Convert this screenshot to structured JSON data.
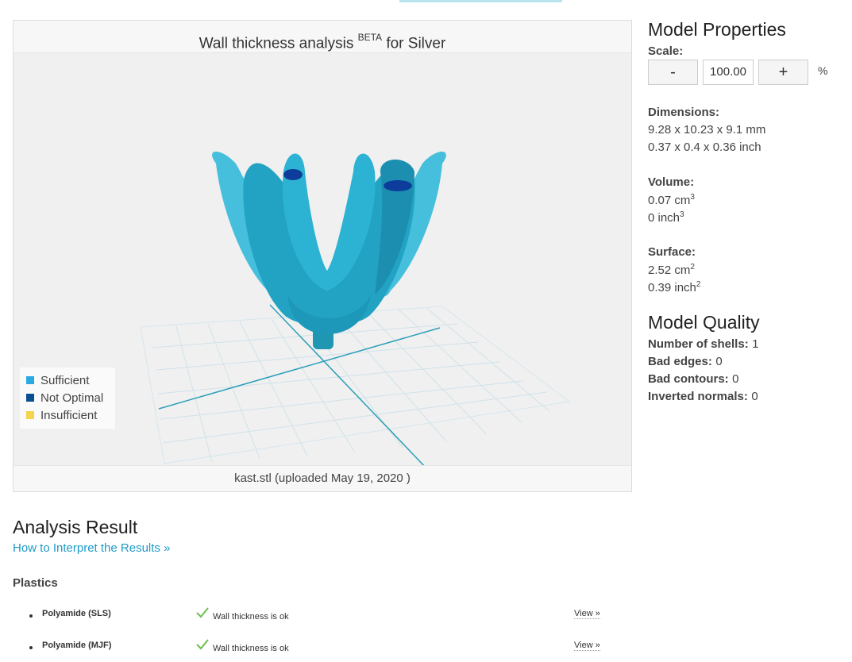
{
  "viewer": {
    "title_main": "Wall thickness analysis ",
    "title_sup": "BETA",
    "title_suffix": " for Silver",
    "footer": "kast.stl (uploaded May 19, 2020 )",
    "legend": [
      {
        "label": "Sufficient",
        "color": "#29abe2"
      },
      {
        "label": "Not Optimal",
        "color": "#0b4f93"
      },
      {
        "label": "Insufficient",
        "color": "#f5d34a"
      }
    ]
  },
  "model_properties": {
    "title": "Model Properties",
    "scale_label": "Scale:",
    "minus": "-",
    "scale_value": "100.00",
    "plus": "+",
    "percent": "%",
    "dimensions_label": "Dimensions:",
    "dimensions_mm": "9.28 x 10.23 x 9.1 mm",
    "dimensions_inch": "0.37 x 0.4 x 0.36 inch",
    "volume_label": "Volume:",
    "volume_cm": "0.07 cm",
    "volume_inch": "0 inch",
    "volume_exp": "3",
    "surface_label": "Surface:",
    "surface_cm": "2.52 cm",
    "surface_inch": "0.39 inch",
    "surface_exp": "2"
  },
  "model_quality": {
    "title": "Model Quality",
    "shells_label": "Number of shells:",
    "shells": "1",
    "edges_label": "Bad edges:",
    "edges": "0",
    "contours_label": "Bad contours:",
    "contours": "0",
    "normals_label": "Inverted normals:",
    "normals": "0"
  },
  "analysis": {
    "title": "Analysis Result",
    "link": "How to Interpret the Results »",
    "category": "Plastics",
    "rows": [
      {
        "material": "Polyamide (SLS)",
        "status": "Wall thickness is ok",
        "action": "View »"
      },
      {
        "material": "Polyamide (MJF)",
        "status": "Wall thickness is ok",
        "action": "View »"
      }
    ]
  },
  "colors": {
    "accent_link": "#1e9bc6",
    "model": "#29a9c8",
    "check": "#6cbf4a"
  }
}
